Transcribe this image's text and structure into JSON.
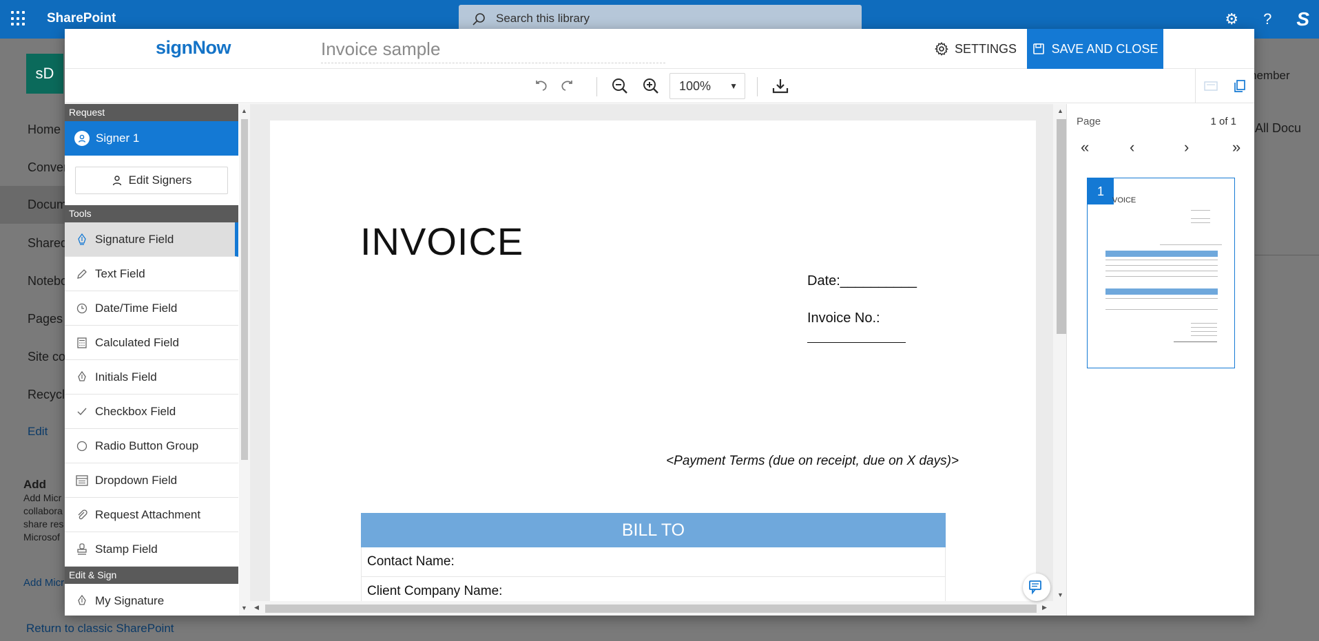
{
  "sharepoint": {
    "brand": "SharePoint",
    "search_placeholder": "Search this library",
    "site_logo": "sD",
    "member_text": "nember",
    "nav": [
      "Home",
      "Conver",
      "Docum",
      "Shared",
      "Notebo",
      "Pages",
      "Site co",
      "Recycle"
    ],
    "edit": "Edit",
    "teams_title": "Add",
    "teams_text": [
      "Add Micr",
      "collabora",
      "share res",
      "Microsof"
    ],
    "add_micro": "Add Micr",
    "return_link": "Return to classic SharePoint",
    "all_docs": "All Docu"
  },
  "header": {
    "logo": "signNow",
    "doc_title": "Invoice sample",
    "settings_label": "SETTINGS",
    "save_label": "SAVE AND CLOSE"
  },
  "toolbar": {
    "zoom_value": "100%"
  },
  "left_panel": {
    "request_header": "Request",
    "signer": "Signer 1",
    "edit_signers": "Edit Signers",
    "tools_header": "Tools",
    "tools": [
      {
        "label": "Signature Field",
        "icon": "pen-nib-icon"
      },
      {
        "label": "Text Field",
        "icon": "pencil-icon"
      },
      {
        "label": "Date/Time Field",
        "icon": "clock-icon"
      },
      {
        "label": "Calculated Field",
        "icon": "calculator-icon"
      },
      {
        "label": "Initials Field",
        "icon": "pen-nib-icon"
      },
      {
        "label": "Checkbox Field",
        "icon": "check-icon"
      },
      {
        "label": "Radio Button Group",
        "icon": "radio-icon"
      },
      {
        "label": "Dropdown Field",
        "icon": "dropdown-icon"
      },
      {
        "label": "Request Attachment",
        "icon": "paperclip-icon"
      },
      {
        "label": "Stamp Field",
        "icon": "stamp-icon"
      }
    ],
    "edit_sign_header": "Edit & Sign",
    "edit_sign_tools": [
      {
        "label": "My Signature",
        "icon": "pen-nib-icon"
      }
    ]
  },
  "document": {
    "title": "INVOICE",
    "date_label": "Date:__________",
    "invoice_no_label": "Invoice No.:",
    "payment_terms": "<Payment Terms (due on receipt, due on X days)>",
    "bill_to": "BILL TO",
    "rows": [
      "Contact Name:",
      "Client Company Name:"
    ]
  },
  "pages_panel": {
    "label": "Page",
    "count": "1 of 1",
    "thumb_number": "1",
    "thumb_title": "VOICE"
  },
  "colors": {
    "accent": "#1479d4",
    "billto_fill": "#6fa8dc",
    "sp_topbar": "#0f6cbd"
  }
}
